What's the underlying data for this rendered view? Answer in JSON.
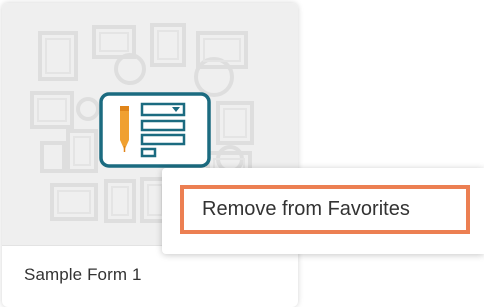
{
  "card": {
    "title": "Sample Form 1",
    "thumbnail_icon": "form-edit-icon",
    "thumbnail_background": "picture-frames-pattern"
  },
  "context_menu": {
    "items": [
      {
        "label": "Remove from Favorites",
        "highlighted": true
      }
    ]
  },
  "colors": {
    "accent_highlight": "#ec7f52",
    "icon_teal": "#1b6b80",
    "pencil_orange": "#f0a030",
    "thumb_bg": "#efefef"
  }
}
